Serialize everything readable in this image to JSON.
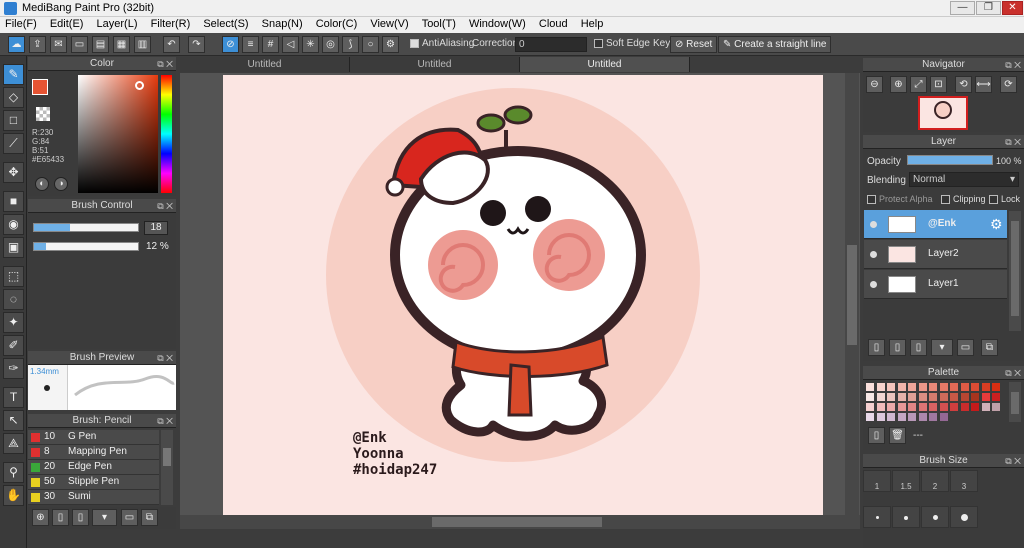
{
  "window": {
    "title": "MediBang Paint Pro (32bit)",
    "min": "—",
    "max": "❐",
    "close": "✕"
  },
  "menu": [
    "File(F)",
    "Edit(E)",
    "Layer(L)",
    "Filter(R)",
    "Select(S)",
    "Snap(N)",
    "Color(C)",
    "View(V)",
    "Tool(T)",
    "Window(W)",
    "Cloud",
    "Help"
  ],
  "toolbar": {
    "antialiasing": "AntiAliasing",
    "correction_label": "Correction",
    "correction_value": "0",
    "soft_edge": "Soft Edge",
    "key": "Key",
    "reset": "Reset",
    "straight_line": "Create a straight line"
  },
  "tabs": [
    "Untitled",
    "Untitled",
    "Untitled"
  ],
  "color_panel": {
    "title": "Color",
    "r": "R:230",
    "g": "G:84",
    "b": "B:51",
    "hex": "#E65433",
    "main_color": "#e65433"
  },
  "brush_control": {
    "title": "Brush Control",
    "size": "18",
    "opacity": "12 %",
    "size_fraction": 0.35,
    "opacity_fraction": 0.12
  },
  "brush_preview": {
    "title": "Brush Preview",
    "size": "1.34mm"
  },
  "brush_list": {
    "title": "Brush: Pencil",
    "items": [
      {
        "size": "10",
        "name": "G Pen",
        "color": "#e03030"
      },
      {
        "size": "8",
        "name": "Mapping Pen",
        "color": "#e03030"
      },
      {
        "size": "20",
        "name": "Edge Pen",
        "color": "#3aa83a"
      },
      {
        "size": "50",
        "name": "Stipple Pen",
        "color": "#e8d020"
      },
      {
        "size": "30",
        "name": "Sumi",
        "color": "#e8d020"
      }
    ]
  },
  "navigator": {
    "title": "Navigator"
  },
  "layer_panel": {
    "title": "Layer",
    "opacity_label": "Opacity",
    "opacity_value": "100 %",
    "opacity_fraction": 1.0,
    "blending_label": "Blending",
    "blending_value": "Normal",
    "protect_alpha": "Protect Alpha",
    "clipping": "Clipping",
    "lock": "Lock",
    "layers": [
      "@Enk",
      "Layer2",
      "Layer1"
    ]
  },
  "palette": {
    "title": "Palette",
    "name": "---"
  },
  "brush_size": {
    "title": "Brush Size",
    "sizes": [
      "1",
      "1.5",
      "2",
      "3"
    ]
  },
  "artwork": {
    "line1": "@Enk",
    "line2": "Yoonna",
    "line3": "#hoidap247"
  }
}
